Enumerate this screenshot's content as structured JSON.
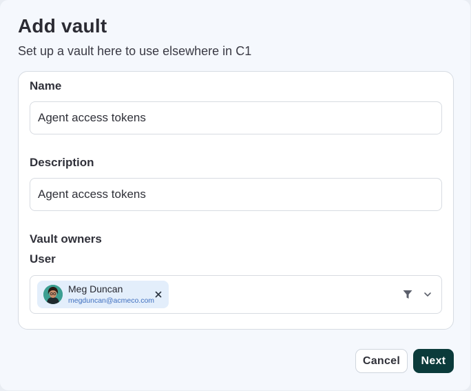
{
  "dialog": {
    "title": "Add vault",
    "subtitle": "Set up a vault here to use elsewhere in C1"
  },
  "form": {
    "name": {
      "label": "Name",
      "value": "Agent access tokens"
    },
    "description": {
      "label": "Description",
      "value": "Agent access tokens"
    },
    "owners": {
      "section_label": "Vault owners",
      "user_label": "User",
      "selected": [
        {
          "name": "Meg Duncan",
          "email": "megduncan@acmeco.com"
        }
      ]
    }
  },
  "actions": {
    "cancel_label": "Cancel",
    "next_label": "Next"
  },
  "icons": {
    "remove": "close-icon",
    "filter": "filter-icon",
    "dropdown": "chevron-down-icon"
  },
  "colors": {
    "primary_button": "#0b3b3b",
    "chip_background": "#e3eefb",
    "email_text": "#3f6fbf"
  }
}
